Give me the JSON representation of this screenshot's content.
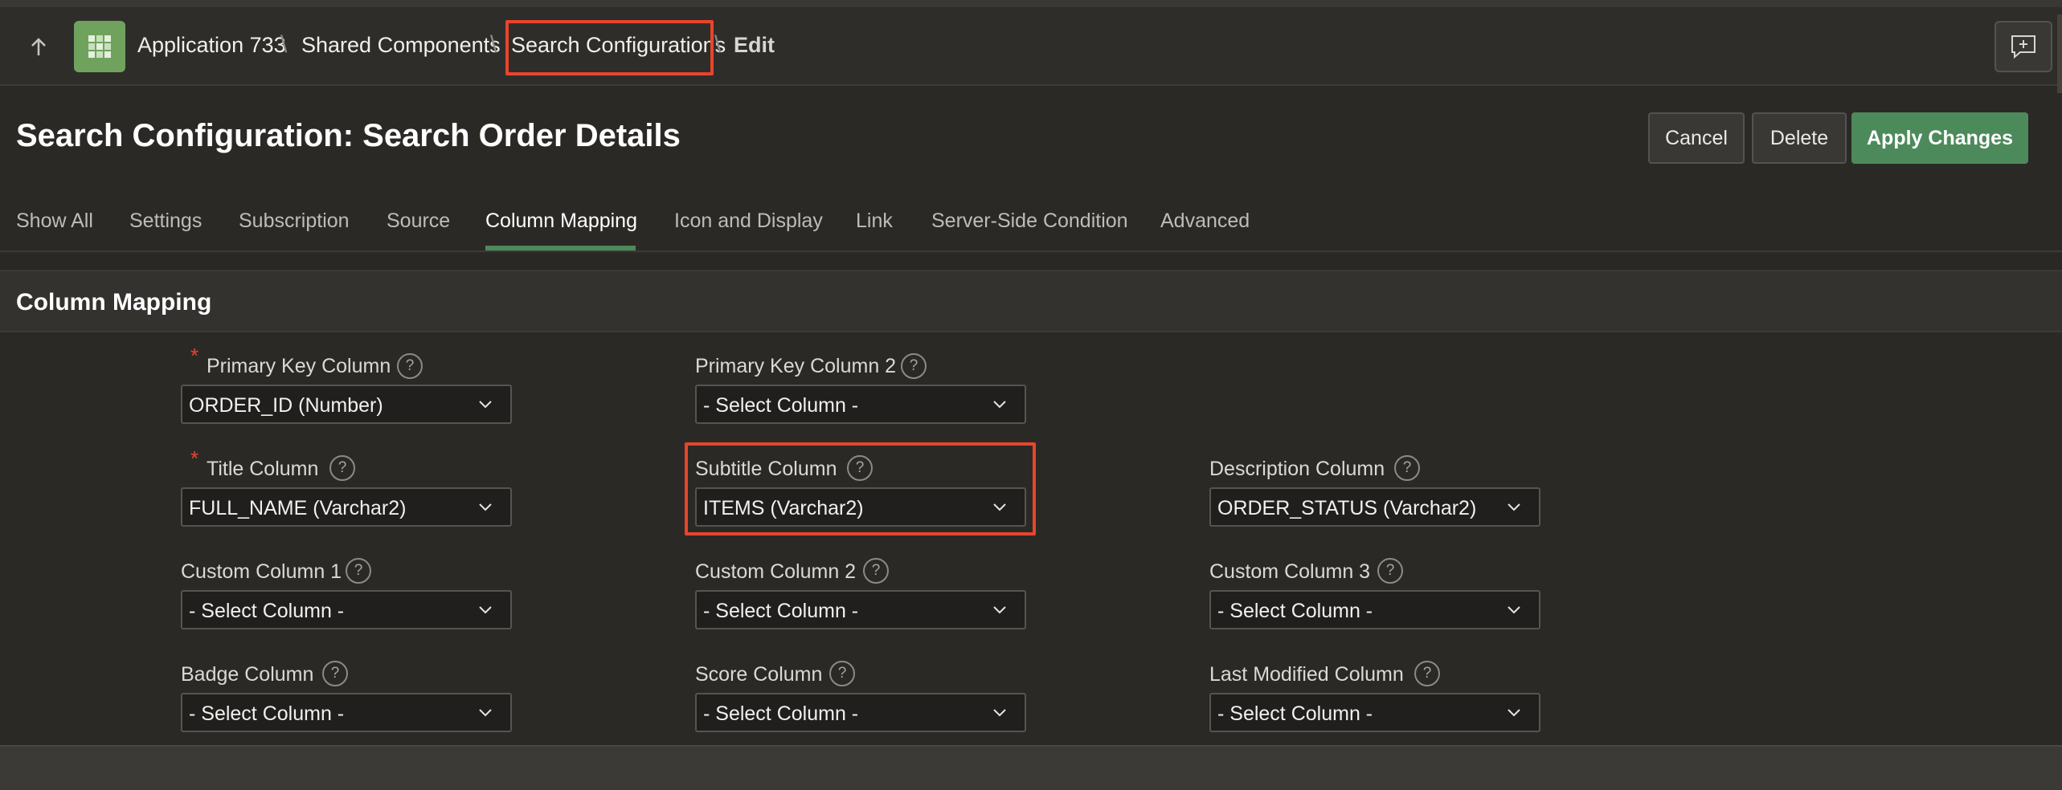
{
  "navbar": {
    "breadcrumbs": [
      {
        "label": "Application 733"
      },
      {
        "label": "Shared Components"
      },
      {
        "label": "Search Configurations"
      },
      {
        "label": "Edit"
      }
    ]
  },
  "header": {
    "title": "Search Configuration: Search Order Details",
    "buttons": {
      "cancel": "Cancel",
      "delete": "Delete",
      "apply": "Apply Changes"
    }
  },
  "tabs": [
    {
      "label": "Show All"
    },
    {
      "label": "Settings"
    },
    {
      "label": "Subscription"
    },
    {
      "label": "Source"
    },
    {
      "label": "Column Mapping"
    },
    {
      "label": "Icon and Display"
    },
    {
      "label": "Link"
    },
    {
      "label": "Server-Side Condition"
    },
    {
      "label": "Advanced"
    }
  ],
  "active_tab": "Column Mapping",
  "region": {
    "title": "Column Mapping",
    "fields": {
      "primary_key": {
        "label": "Primary Key Column",
        "value": "ORDER_ID (Number)",
        "required": true
      },
      "primary_key_2": {
        "label": "Primary Key Column 2",
        "value": "- Select Column -"
      },
      "title": {
        "label": "Title Column",
        "value": "FULL_NAME (Varchar2)",
        "required": true
      },
      "subtitle": {
        "label": "Subtitle Column",
        "value": "ITEMS (Varchar2)"
      },
      "description": {
        "label": "Description Column",
        "value": "ORDER_STATUS (Varchar2)"
      },
      "custom1": {
        "label": "Custom Column 1",
        "value": "- Select Column -"
      },
      "custom2": {
        "label": "Custom Column 2",
        "value": "- Select Column -"
      },
      "custom3": {
        "label": "Custom Column 3",
        "value": "- Select Column -"
      },
      "badge": {
        "label": "Badge Column",
        "value": "- Select Column -"
      },
      "score": {
        "label": "Score Column",
        "value": "- Select Column -"
      },
      "last_modified": {
        "label": "Last Modified Column",
        "value": "- Select Column -"
      }
    }
  },
  "colors": {
    "accent_green": "#4d8a5b",
    "highlight_red": "#e8452c",
    "app_icon_green": "#6fa35d",
    "background": "#2b2926"
  },
  "icons": {
    "up": "arrow-up-icon",
    "app": "app-grid-icon",
    "feedback": "feedback-icon",
    "help": "help-icon",
    "chevron": "chevron-down-icon"
  },
  "help_glyph": "?"
}
